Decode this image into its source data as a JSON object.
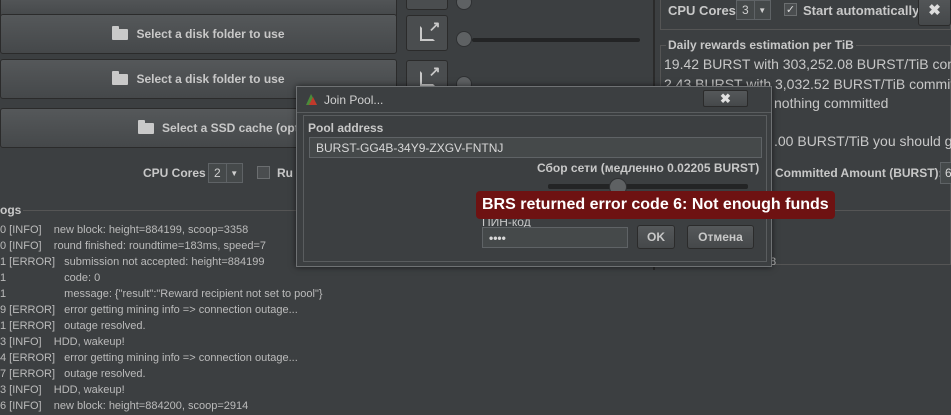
{
  "buttons": {
    "select_folder_1": "Select a disk folder to use",
    "select_folder_2": "Select a disk folder to use",
    "select_ssd": "Select a SSD cache (opti",
    "start_auto": "Start automatically"
  },
  "cpu": {
    "label_left": "CPU Cores",
    "value_left": "2",
    "run_label": "Ru",
    "label_right": "CPU Cores",
    "value_right": "3"
  },
  "rewards": {
    "title": "Daily rewards estimation per TiB",
    "line1": "19.42 BURST with 303,252.08 BURST/TiB com",
    "line2": "2.43 BURST with 3,032.52 BURST/TiB committ",
    "line3": "nothing committed",
    "line4": ".00 BURST/TiB you should g",
    "committed_label": "Committed Amount (BURST):",
    "committed_value": "6"
  },
  "logs": {
    "title": "ogs",
    "lines": [
      "0 [INFO]    new block: height=884199, scoop=3358",
      "0 [INFO]    round finished: roundtime=183ms, speed=7",
      "1 [ERROR]   submission not accepted: height=884199",
      "1                   code: 0",
      "1                   message: {\"result\":\"Reward recipient not set to pool\"}",
      "9 [ERROR]   error getting mining info => connection outage...",
      "1 [ERROR]   outage resolved.",
      "3 [INFO]    HDD, wakeup!",
      "4 [ERROR]   error getting mining info => connection outage...",
      "7 [ERROR]   outage resolved.",
      "3 [INFO]    HDD, wakeup!",
      "6 [INFO]    new block: height=884200, scoop=2914"
    ],
    "right_fragment": "8"
  },
  "dialog": {
    "title": "Join Pool...",
    "close": "✖",
    "pool_label": "Pool address",
    "pool_value": "BURST-GG4B-34Y9-ZXGV-FNTNJ",
    "fee_label": "Сбор сети (медленно 0.02205 BURST)",
    "pin_label": "ПИН-код",
    "pin_value": "••••",
    "ok": "OK",
    "cancel": "Отмена"
  },
  "error_banner": "BRS returned error code 6: Not enough funds",
  "colors": {
    "error_bg": "#6e1212",
    "background": "#3c3f41"
  }
}
